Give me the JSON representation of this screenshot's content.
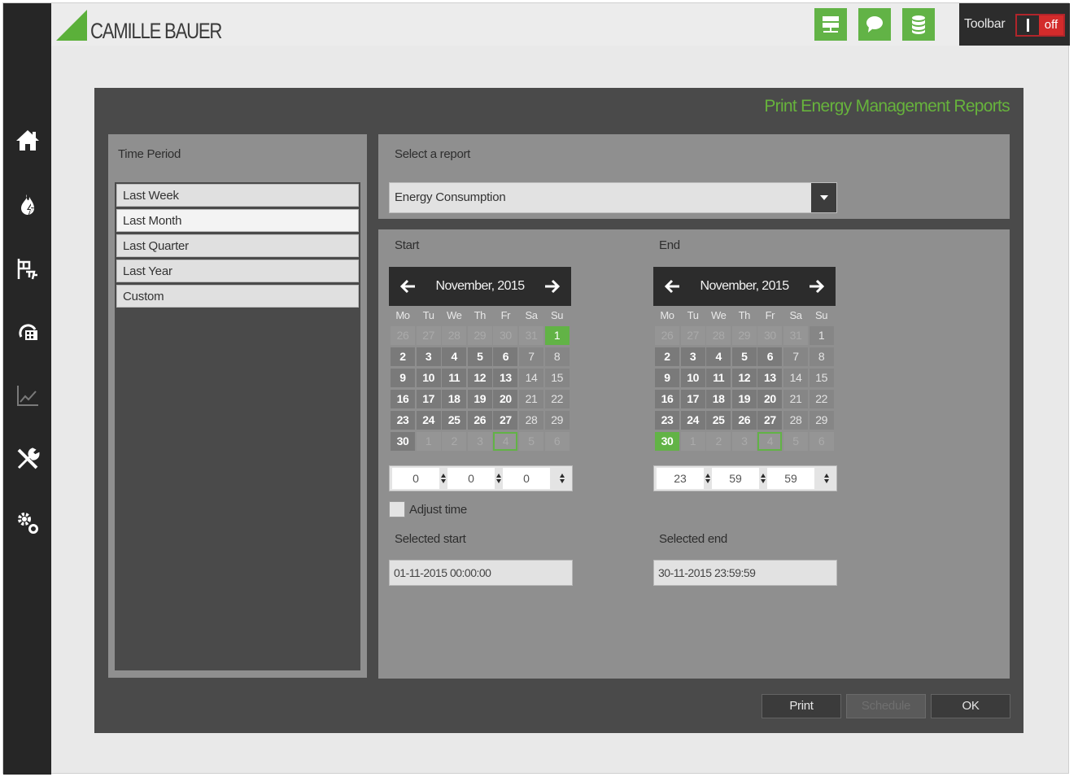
{
  "header": {
    "logo_text": "CAMILLE BAUER",
    "icons": [
      "network-icon",
      "chat-icon",
      "database-icon"
    ],
    "toolbar_label": "Toolbar",
    "toggle_on_symbol": "I",
    "toggle_off_label": "off"
  },
  "sidebar": {
    "items": [
      "home-icon",
      "energy-icon",
      "production-icon",
      "meter-icon",
      "trend-chart-icon",
      "tools-icon",
      "settings-icon"
    ]
  },
  "panel": {
    "title": "Print Energy Management Reports"
  },
  "time_period": {
    "label": "Time Period",
    "options": [
      "Last Week",
      "Last Month",
      "Last Quarter",
      "Last Year",
      "Custom"
    ],
    "selected": "Last Month"
  },
  "report": {
    "label": "Select a report",
    "selected": "Energy Consumption"
  },
  "start": {
    "label": "Start",
    "month_title": "November, 2015",
    "time": {
      "hours": "0",
      "minutes": "0",
      "seconds": "0"
    },
    "selected_label": "Selected start",
    "selected_value": "01-11-2015 00:00:00"
  },
  "end": {
    "label": "End",
    "month_title": "November, 2015",
    "time": {
      "hours": "23",
      "minutes": "59",
      "seconds": "59"
    },
    "selected_label": "Selected end",
    "selected_value": "30-11-2015 23:59:59"
  },
  "calendar": {
    "weekdays": [
      "Mo",
      "Tu",
      "We",
      "Th",
      "Fr",
      "Sa",
      "Su"
    ],
    "weeks": [
      [
        "26",
        "27",
        "28",
        "29",
        "30",
        "31",
        "1"
      ],
      [
        "2",
        "3",
        "4",
        "5",
        "6",
        "7",
        "8"
      ],
      [
        "9",
        "10",
        "11",
        "12",
        "13",
        "14",
        "15"
      ],
      [
        "16",
        "17",
        "18",
        "19",
        "20",
        "21",
        "22"
      ],
      [
        "23",
        "24",
        "25",
        "26",
        "27",
        "28",
        "29"
      ],
      [
        "30",
        "1",
        "2",
        "3",
        "4",
        "5",
        "6"
      ]
    ],
    "start_selected_day": "1",
    "end_selected_day": "30",
    "highlighted_day": "4 December"
  },
  "adjust_time": {
    "label": "Adjust time",
    "checked": false
  },
  "buttons": {
    "print": "Print",
    "schedule": "Schedule",
    "ok": "OK"
  },
  "colors": {
    "accent_green": "#62b346",
    "title_green": "#67b33c",
    "toggle_red": "#d32b2b"
  }
}
